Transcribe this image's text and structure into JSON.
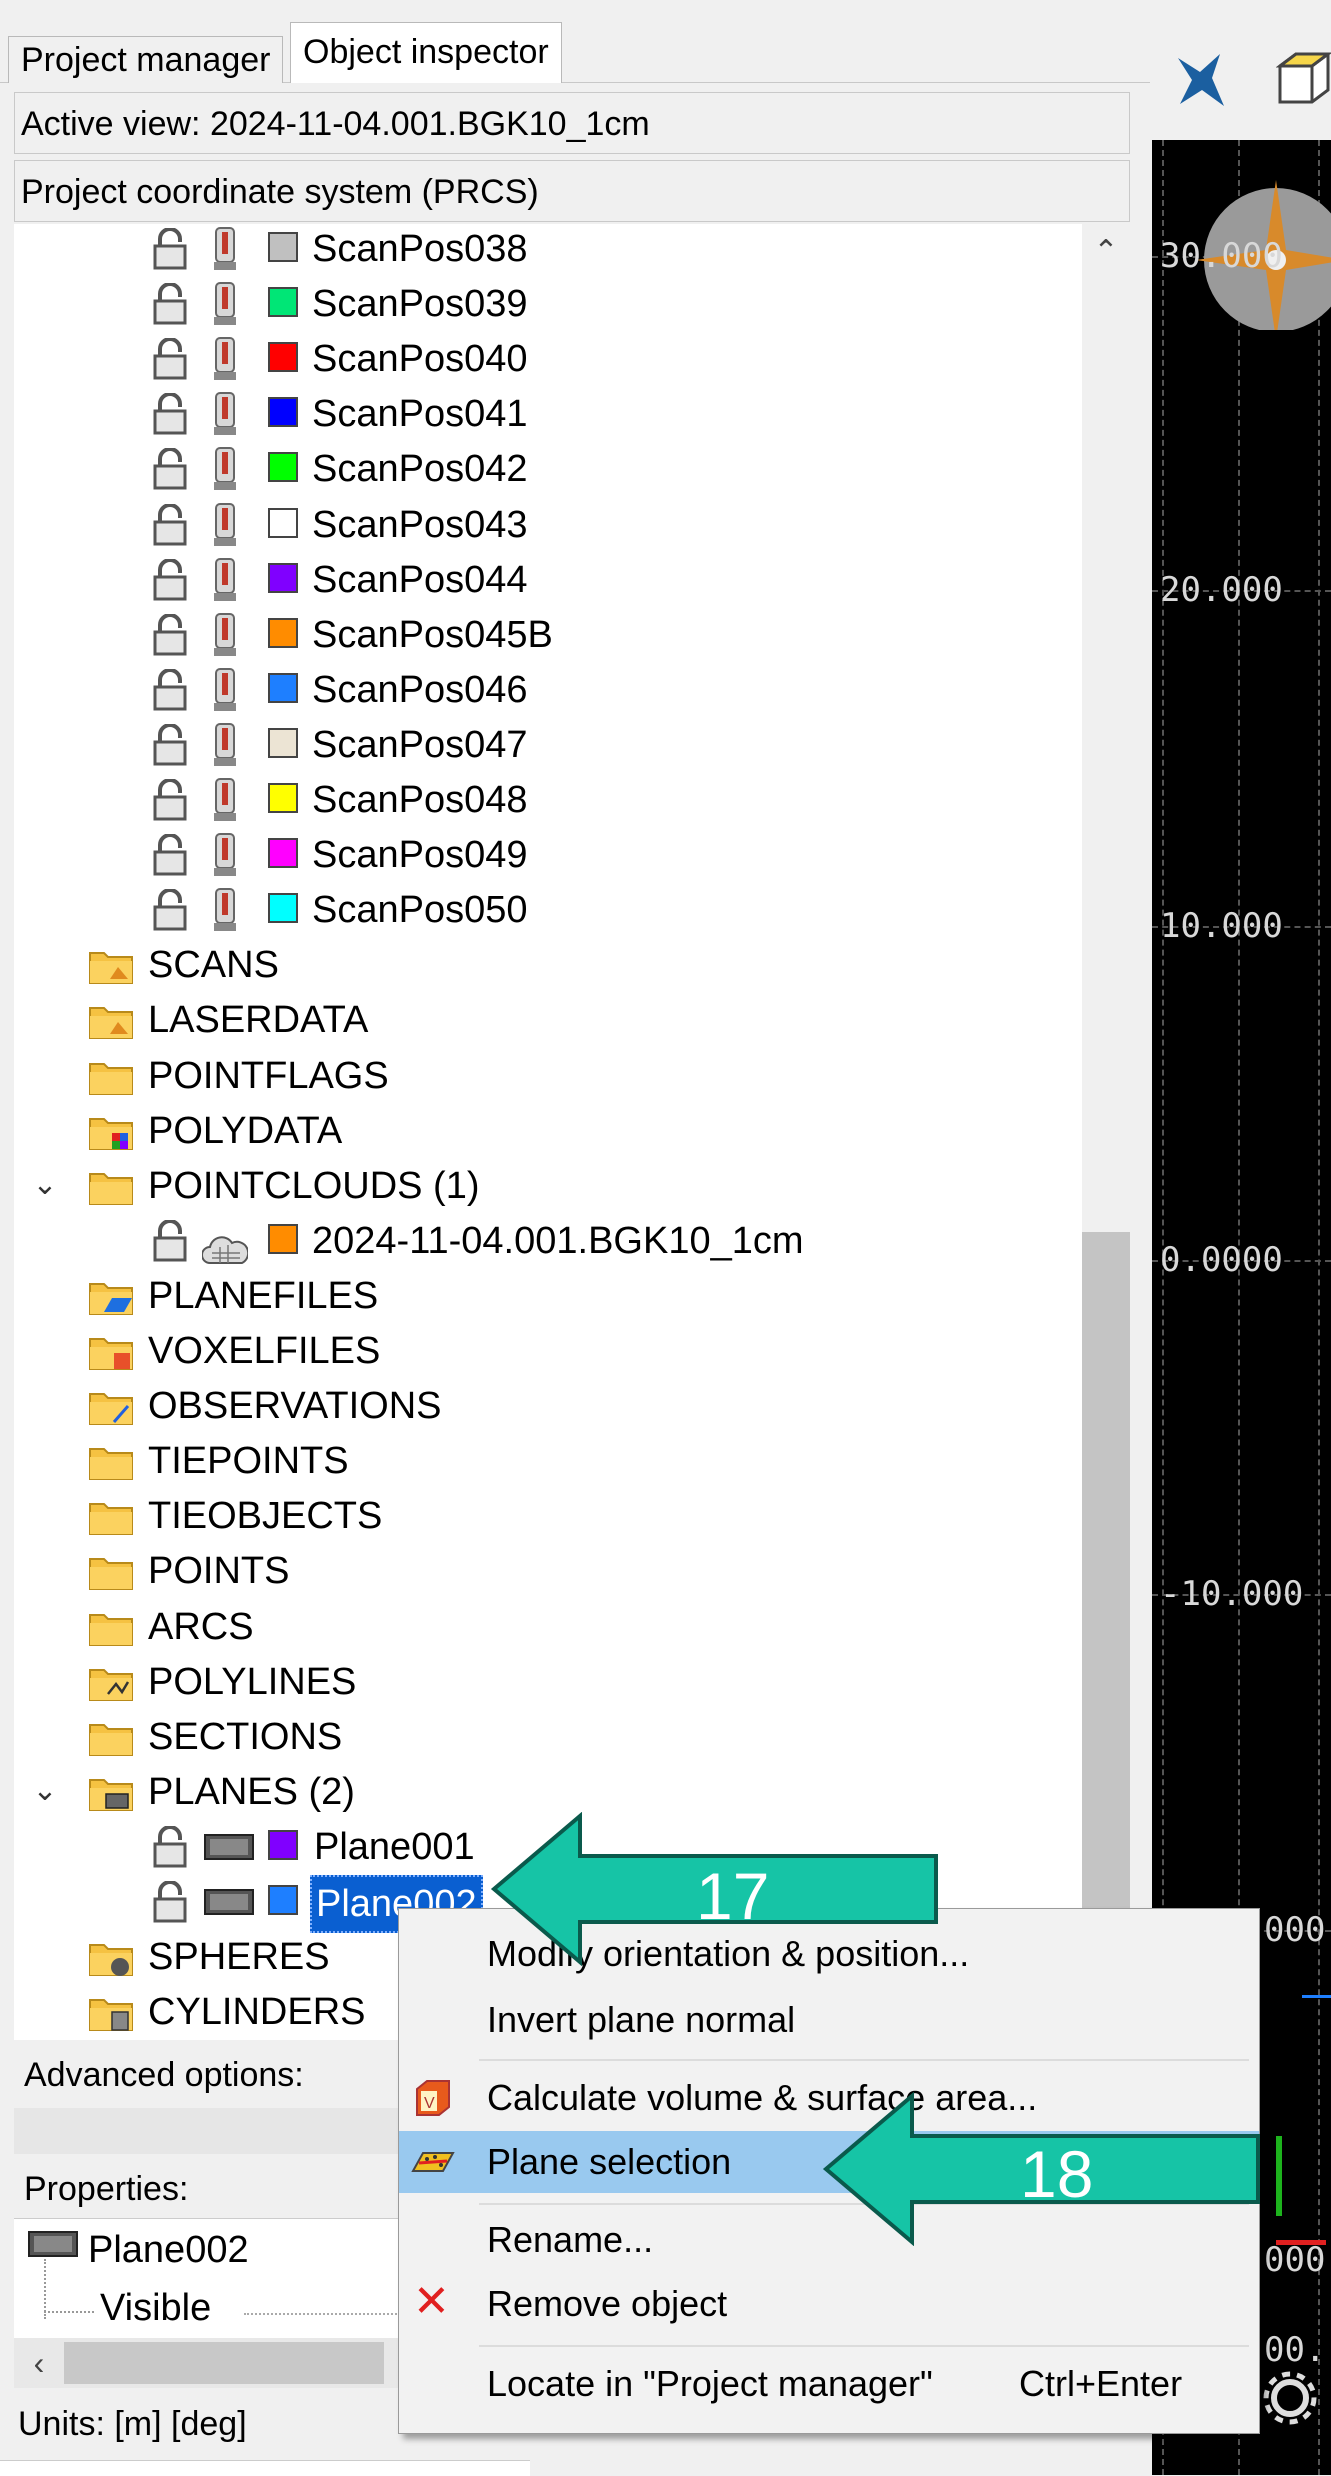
{
  "tabs": [
    {
      "label": "Project manager",
      "active": false
    },
    {
      "label": "Object inspector",
      "active": true
    }
  ],
  "active_view": "Active view: 2024-11-04.001.BGK10_1cm",
  "coordinate_system": "Project coordinate system (PRCS)",
  "scan_positions": [
    {
      "label": "ScanPos038",
      "color": "#c0c0c0"
    },
    {
      "label": "ScanPos039",
      "color": "#00e676"
    },
    {
      "label": "ScanPos040",
      "color": "#ff0000"
    },
    {
      "label": "ScanPos041",
      "color": "#0000ff"
    },
    {
      "label": "ScanPos042",
      "color": "#00ff00"
    },
    {
      "label": "ScanPos043",
      "color": "#ffffff"
    },
    {
      "label": "ScanPos044",
      "color": "#8000ff"
    },
    {
      "label": "ScanPos045B",
      "color": "#ff8c00"
    },
    {
      "label": "ScanPos046",
      "color": "#1e7fff"
    },
    {
      "label": "ScanPos047",
      "color": "#ece4d4"
    },
    {
      "label": "ScanPos048",
      "color": "#ffff00"
    },
    {
      "label": "ScanPos049",
      "color": "#ff00ff"
    },
    {
      "label": "ScanPos050",
      "color": "#00ffff"
    }
  ],
  "folders": {
    "scans": "SCANS",
    "laserdata": "LASERDATA",
    "pointflags": "POINTFLAGS",
    "polydata": "POLYDATA",
    "pointclouds": "POINTCLOUDS (1)",
    "pointcloud_item": "2024-11-04.001.BGK10_1cm",
    "planefiles": "PLANEFILES",
    "voxelfiles": "VOXELFILES",
    "observations": "OBSERVATIONS",
    "tiepoints": "TIEPOINTS",
    "tieobjects": "TIEOBJECTS",
    "points": "POINTS",
    "arcs": "ARCS",
    "polylines": "POLYLINES",
    "sections": "SECTIONS",
    "planes": "PLANES (2)",
    "spheres": "SPHERES",
    "cylinders": "CYLINDERS"
  },
  "planes": [
    {
      "label": "Plane001",
      "color": "#8000ff",
      "selected": false
    },
    {
      "label": "Plane002",
      "color": "#1e7fff",
      "selected": true
    }
  ],
  "pointcloud_color": "#ff8c00",
  "advanced_options": "Advanced options:",
  "properties_label": "Properties:",
  "properties": {
    "object": "Plane002",
    "visible": "Visible"
  },
  "units": "Units: [m] [deg]",
  "view_axis_labels": [
    "30.000",
    "20.000",
    "10.000",
    "0.0000",
    "-10.000",
    "000",
    "000",
    "00."
  ],
  "context_menu": {
    "items": [
      {
        "label": "Modify orientation & position...",
        "icon": "",
        "highlighted": false
      },
      {
        "label": "Invert plane normal",
        "icon": "",
        "highlighted": false
      },
      {
        "label": "Calculate volume & surface area...",
        "icon": "volume-icon",
        "highlighted": false
      },
      {
        "label": "Plane selection",
        "icon": "plane-selection-icon",
        "highlighted": true
      },
      {
        "label": "Rename...",
        "icon": "",
        "highlighted": false
      },
      {
        "label": "Remove object",
        "icon": "remove-icon",
        "highlighted": false
      },
      {
        "label": "Locate in \"Project manager\"",
        "shortcut": "Ctrl+Enter",
        "icon": "",
        "highlighted": false
      }
    ]
  },
  "callouts": [
    "17",
    "18"
  ],
  "colors": {
    "callout_fill": "#16c4a6",
    "selection": "#0a5fd1",
    "menu_highlight": "#99c9ef",
    "folder": "#f5c242"
  }
}
